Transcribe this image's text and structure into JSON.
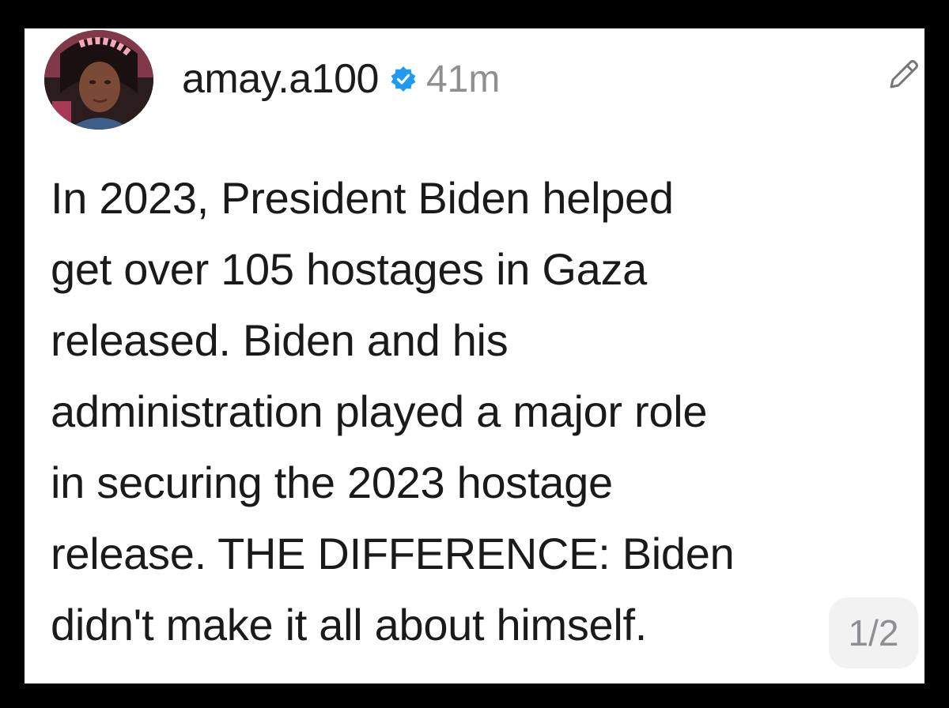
{
  "post": {
    "username": "amay.a100",
    "verified_icon": "verified-badge-icon",
    "timestamp": "41m",
    "edit_icon": "pencil-icon",
    "avatar_icon": "profile-photo",
    "text_lines": [
      "In 2023, President Biden helped",
      "get over 105 hostages in Gaza",
      "released. Biden and his",
      "administration played a major role",
      "in securing the 2023 hostage",
      "release. THE DIFFERENCE:  Biden",
      "didn't make it all about himself."
    ],
    "page_indicator": "1/2"
  },
  "colors": {
    "background": "#000000",
    "card": "#ffffff",
    "text": "#1a1a1a",
    "muted": "#8e8e93",
    "verified": "#1d9bf0"
  }
}
